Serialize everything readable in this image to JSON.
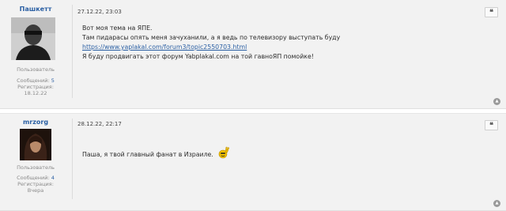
{
  "posts": [
    {
      "author": "Пашкетт",
      "role": "Пользователь",
      "messages_label": "Сообщений:",
      "messages_count": "5",
      "registration_label": "Регистрация:",
      "registration_date": "18.12.22",
      "date": "27.12.22, 23:03",
      "lines": [
        "Вот моя тема на ЯПЕ.",
        "Там пидарасы опять меня зачуханили, а я ведь по телевизору выступать буду",
        "https://www.yaplakal.com/forum3/topic2550703.html",
        "Я буду продвигать этот форум Yabplakal.com на той гавноЯП помойке!"
      ],
      "quote_icon": "quote-icon",
      "top_icon": "scroll-top-icon"
    },
    {
      "author": "mrzorg",
      "role": "Пользователь",
      "messages_label": "Сообщений:",
      "messages_count": "4",
      "registration_label": "Регистрация:",
      "registration_date": "Вчера",
      "date": "28.12.22, 22:17",
      "lines": [
        "Паша, я твой главный фанат в Израиле."
      ],
      "emoji": "peace-smiley-icon",
      "quote_icon": "quote-icon",
      "top_icon": "scroll-top-icon"
    }
  ],
  "colors": {
    "post_bg": "#f2f2f2",
    "link": "#2a5fa3",
    "meta": "#8a8a8a"
  }
}
